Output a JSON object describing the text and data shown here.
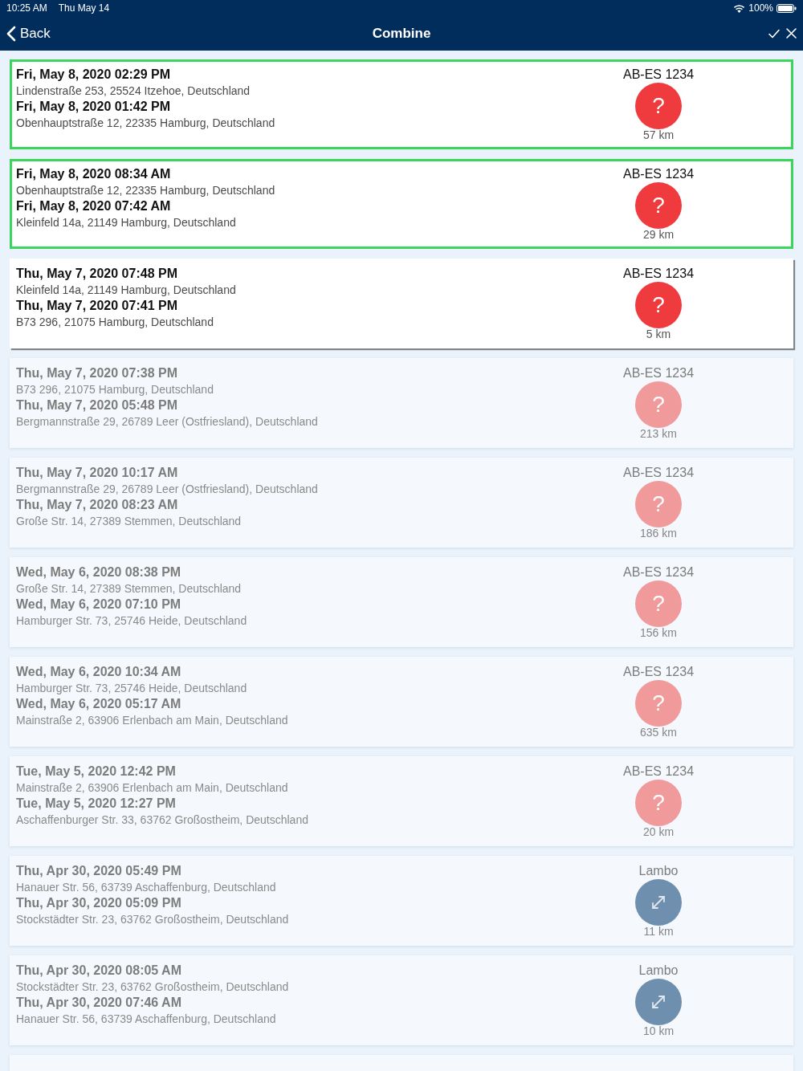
{
  "status_bar": {
    "time": "10:25 AM",
    "date": "Thu May 14",
    "battery": "100%"
  },
  "nav_bar": {
    "back": "Back",
    "title": "Combine"
  },
  "trips": [
    {
      "selected": true,
      "dimmed": false,
      "stops": [
        {
          "time": "Fri, May 8, 2020 02:29 PM",
          "address": "Lindenstraße 253, 25524 Itzehoe, Deutschland"
        },
        {
          "time": "Fri, May 8, 2020 01:42 PM",
          "address": "Obenhauptstraße 12, 22335 Hamburg, Deutschland"
        }
      ],
      "vehicle": "AB-ES 1234",
      "badge": {
        "kind": "glyph",
        "text": "?",
        "color": "#ef3b3e"
      },
      "distance": "57 km"
    },
    {
      "selected": true,
      "dimmed": false,
      "stops": [
        {
          "time": "Fri, May 8, 2020 08:34 AM",
          "address": "Obenhauptstraße 12, 22335 Hamburg, Deutschland"
        },
        {
          "time": "Fri, May 8, 2020 07:42 AM",
          "address": "Kleinfeld 14a, 21149 Hamburg, Deutschland"
        }
      ],
      "vehicle": "AB-ES 1234",
      "badge": {
        "kind": "glyph",
        "text": "?",
        "color": "#ef3b3e"
      },
      "distance": "29 km"
    },
    {
      "selected": false,
      "dimmed": false,
      "stops": [
        {
          "time": "Thu, May 7, 2020 07:48 PM",
          "address": "Kleinfeld 14a, 21149 Hamburg, Deutschland"
        },
        {
          "time": "Thu, May 7, 2020 07:41 PM",
          "address": "B73 296, 21075 Hamburg, Deutschland"
        }
      ],
      "vehicle": "AB-ES 1234",
      "badge": {
        "kind": "glyph",
        "text": "?",
        "color": "#ef3b3e"
      },
      "distance": "5 km"
    },
    {
      "selected": false,
      "dimmed": true,
      "stops": [
        {
          "time": "Thu, May 7, 2020 07:38 PM",
          "address": "B73 296, 21075 Hamburg, Deutschland"
        },
        {
          "time": "Thu, May 7, 2020 05:48 PM",
          "address": "Bergmannstraße 29, 26789 Leer (Ostfriesland), Deutschland"
        }
      ],
      "vehicle": "AB-ES 1234",
      "badge": {
        "kind": "glyph",
        "text": "?",
        "color": "#f09a9c"
      },
      "distance": "213 km"
    },
    {
      "selected": false,
      "dimmed": true,
      "stops": [
        {
          "time": "Thu, May 7, 2020 10:17 AM",
          "address": "Bergmannstraße 29, 26789 Leer (Ostfriesland), Deutschland"
        },
        {
          "time": "Thu, May 7, 2020 08:23 AM",
          "address": "Große Str. 14, 27389 Stemmen, Deutschland"
        }
      ],
      "vehicle": "AB-ES 1234",
      "badge": {
        "kind": "glyph",
        "text": "?",
        "color": "#f09a9c"
      },
      "distance": "186 km"
    },
    {
      "selected": false,
      "dimmed": true,
      "stops": [
        {
          "time": "Wed, May 6, 2020 08:38 PM",
          "address": "Große Str. 14, 27389 Stemmen, Deutschland"
        },
        {
          "time": "Wed, May 6, 2020 07:10 PM",
          "address": "Hamburger Str. 73, 25746 Heide, Deutschland"
        }
      ],
      "vehicle": "AB-ES 1234",
      "badge": {
        "kind": "glyph",
        "text": "?",
        "color": "#f09a9c"
      },
      "distance": "156 km"
    },
    {
      "selected": false,
      "dimmed": true,
      "stops": [
        {
          "time": "Wed, May 6, 2020 10:34 AM",
          "address": "Hamburger Str. 73, 25746 Heide, Deutschland"
        },
        {
          "time": "Wed, May 6, 2020 05:17 AM",
          "address": "Mainstraße 2, 63906 Erlenbach am Main, Deutschland"
        }
      ],
      "vehicle": "AB-ES 1234",
      "badge": {
        "kind": "glyph",
        "text": "?",
        "color": "#f09a9c"
      },
      "distance": "635 km"
    },
    {
      "selected": false,
      "dimmed": true,
      "stops": [
        {
          "time": "Tue, May 5, 2020 12:42 PM",
          "address": "Mainstraße 2, 63906 Erlenbach am Main, Deutschland"
        },
        {
          "time": "Tue, May 5, 2020 12:27 PM",
          "address": "Aschaffenburger Str. 33, 63762 Großostheim, Deutschland"
        }
      ],
      "vehicle": "AB-ES 1234",
      "badge": {
        "kind": "glyph",
        "text": "?",
        "color": "#f09a9c"
      },
      "distance": "20 km"
    },
    {
      "selected": false,
      "dimmed": true,
      "stops": [
        {
          "time": "Thu, Apr 30, 2020 05:49 PM",
          "address": "Hanauer Str. 56, 63739 Aschaffenburg, Deutschland"
        },
        {
          "time": "Thu, Apr 30, 2020 05:09 PM",
          "address": "Stockstädter Str. 23, 63762 Großostheim, Deutschland"
        }
      ],
      "vehicle": "Lambo",
      "badge": {
        "kind": "arrows",
        "color": "#6f8fae"
      },
      "distance": "11 km"
    },
    {
      "selected": false,
      "dimmed": true,
      "stops": [
        {
          "time": "Thu, Apr 30, 2020 08:05 AM",
          "address": "Stockstädter Str. 23, 63762 Großostheim, Deutschland"
        },
        {
          "time": "Thu, Apr 30, 2020 07:46 AM",
          "address": "Hanauer Str. 56, 63739 Aschaffenburg, Deutschland"
        }
      ],
      "vehicle": "Lambo",
      "badge": {
        "kind": "arrows",
        "color": "#6f8fae"
      },
      "distance": "10 km"
    }
  ],
  "more_below": true
}
